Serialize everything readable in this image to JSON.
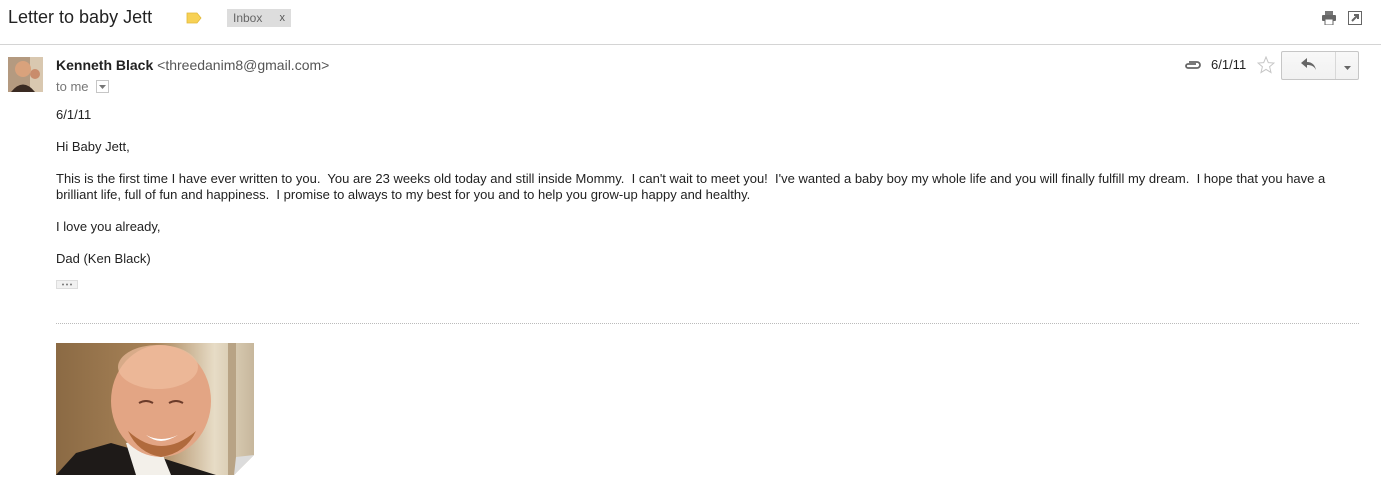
{
  "subject": "Letter to baby Jett",
  "labels": {
    "inbox_label": "Inbox",
    "remove_symbol": "x"
  },
  "sender": {
    "name": "Kenneth Black",
    "email": "<threedanim8@gmail.com>",
    "to_line": "to me",
    "date": "6/1/11"
  },
  "body": {
    "date_line": "6/1/11",
    "greeting": "Hi Baby Jett,",
    "paragraph": "This is the first time I have ever written to you.  You are 23 weeks old today and still inside Mommy.  I can't wait to meet you!  I've wanted a baby boy my whole life and you will finally fulfill my dream.  I hope that you have a brilliant life, full of fun and happiness.  I promise to always to my best for you and to help you grow-up happy and healthy.",
    "closing": "I love you already,",
    "signature": "Dad (Ken Black)"
  },
  "icons": {
    "label_tag": "label-tag-icon",
    "print": "print-icon",
    "new_window": "new-window-icon",
    "attachment": "paperclip-icon",
    "star": "star-icon",
    "reply": "reply-icon",
    "more": "chevron-down-icon",
    "recipient_details": "chevron-down-icon",
    "trimmed_content": "ellipsis-icon"
  },
  "colors": {
    "label_tag": "#f7d155",
    "chip_bg": "#dddddd",
    "divider": "#d4d4d4"
  }
}
